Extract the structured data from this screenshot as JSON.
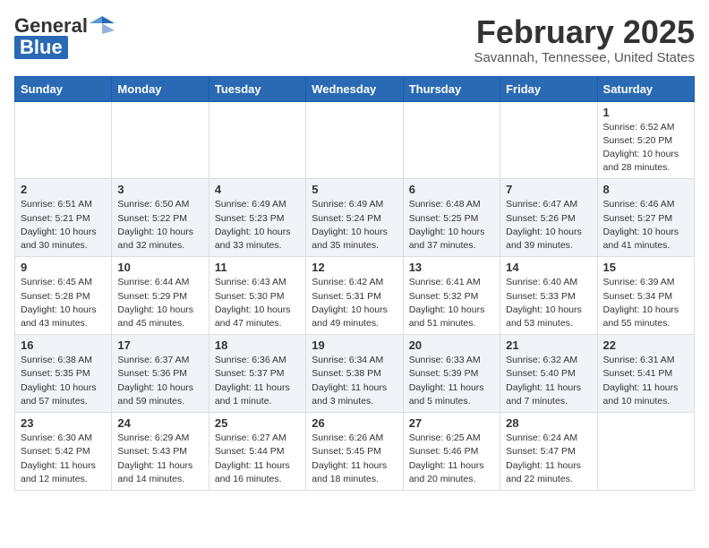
{
  "header": {
    "logo_general": "General",
    "logo_blue": "Blue",
    "month_year": "February 2025",
    "location": "Savannah, Tennessee, United States"
  },
  "weekdays": [
    "Sunday",
    "Monday",
    "Tuesday",
    "Wednesday",
    "Thursday",
    "Friday",
    "Saturday"
  ],
  "weeks": [
    [
      {
        "day": "",
        "info": ""
      },
      {
        "day": "",
        "info": ""
      },
      {
        "day": "",
        "info": ""
      },
      {
        "day": "",
        "info": ""
      },
      {
        "day": "",
        "info": ""
      },
      {
        "day": "",
        "info": ""
      },
      {
        "day": "1",
        "info": "Sunrise: 6:52 AM\nSunset: 5:20 PM\nDaylight: 10 hours and 28 minutes."
      }
    ],
    [
      {
        "day": "2",
        "info": "Sunrise: 6:51 AM\nSunset: 5:21 PM\nDaylight: 10 hours and 30 minutes."
      },
      {
        "day": "3",
        "info": "Sunrise: 6:50 AM\nSunset: 5:22 PM\nDaylight: 10 hours and 32 minutes."
      },
      {
        "day": "4",
        "info": "Sunrise: 6:49 AM\nSunset: 5:23 PM\nDaylight: 10 hours and 33 minutes."
      },
      {
        "day": "5",
        "info": "Sunrise: 6:49 AM\nSunset: 5:24 PM\nDaylight: 10 hours and 35 minutes."
      },
      {
        "day": "6",
        "info": "Sunrise: 6:48 AM\nSunset: 5:25 PM\nDaylight: 10 hours and 37 minutes."
      },
      {
        "day": "7",
        "info": "Sunrise: 6:47 AM\nSunset: 5:26 PM\nDaylight: 10 hours and 39 minutes."
      },
      {
        "day": "8",
        "info": "Sunrise: 6:46 AM\nSunset: 5:27 PM\nDaylight: 10 hours and 41 minutes."
      }
    ],
    [
      {
        "day": "9",
        "info": "Sunrise: 6:45 AM\nSunset: 5:28 PM\nDaylight: 10 hours and 43 minutes."
      },
      {
        "day": "10",
        "info": "Sunrise: 6:44 AM\nSunset: 5:29 PM\nDaylight: 10 hours and 45 minutes."
      },
      {
        "day": "11",
        "info": "Sunrise: 6:43 AM\nSunset: 5:30 PM\nDaylight: 10 hours and 47 minutes."
      },
      {
        "day": "12",
        "info": "Sunrise: 6:42 AM\nSunset: 5:31 PM\nDaylight: 10 hours and 49 minutes."
      },
      {
        "day": "13",
        "info": "Sunrise: 6:41 AM\nSunset: 5:32 PM\nDaylight: 10 hours and 51 minutes."
      },
      {
        "day": "14",
        "info": "Sunrise: 6:40 AM\nSunset: 5:33 PM\nDaylight: 10 hours and 53 minutes."
      },
      {
        "day": "15",
        "info": "Sunrise: 6:39 AM\nSunset: 5:34 PM\nDaylight: 10 hours and 55 minutes."
      }
    ],
    [
      {
        "day": "16",
        "info": "Sunrise: 6:38 AM\nSunset: 5:35 PM\nDaylight: 10 hours and 57 minutes."
      },
      {
        "day": "17",
        "info": "Sunrise: 6:37 AM\nSunset: 5:36 PM\nDaylight: 10 hours and 59 minutes."
      },
      {
        "day": "18",
        "info": "Sunrise: 6:36 AM\nSunset: 5:37 PM\nDaylight: 11 hours and 1 minute."
      },
      {
        "day": "19",
        "info": "Sunrise: 6:34 AM\nSunset: 5:38 PM\nDaylight: 11 hours and 3 minutes."
      },
      {
        "day": "20",
        "info": "Sunrise: 6:33 AM\nSunset: 5:39 PM\nDaylight: 11 hours and 5 minutes."
      },
      {
        "day": "21",
        "info": "Sunrise: 6:32 AM\nSunset: 5:40 PM\nDaylight: 11 hours and 7 minutes."
      },
      {
        "day": "22",
        "info": "Sunrise: 6:31 AM\nSunset: 5:41 PM\nDaylight: 11 hours and 10 minutes."
      }
    ],
    [
      {
        "day": "23",
        "info": "Sunrise: 6:30 AM\nSunset: 5:42 PM\nDaylight: 11 hours and 12 minutes."
      },
      {
        "day": "24",
        "info": "Sunrise: 6:29 AM\nSunset: 5:43 PM\nDaylight: 11 hours and 14 minutes."
      },
      {
        "day": "25",
        "info": "Sunrise: 6:27 AM\nSunset: 5:44 PM\nDaylight: 11 hours and 16 minutes."
      },
      {
        "day": "26",
        "info": "Sunrise: 6:26 AM\nSunset: 5:45 PM\nDaylight: 11 hours and 18 minutes."
      },
      {
        "day": "27",
        "info": "Sunrise: 6:25 AM\nSunset: 5:46 PM\nDaylight: 11 hours and 20 minutes."
      },
      {
        "day": "28",
        "info": "Sunrise: 6:24 AM\nSunset: 5:47 PM\nDaylight: 11 hours and 22 minutes."
      },
      {
        "day": "",
        "info": ""
      }
    ]
  ]
}
